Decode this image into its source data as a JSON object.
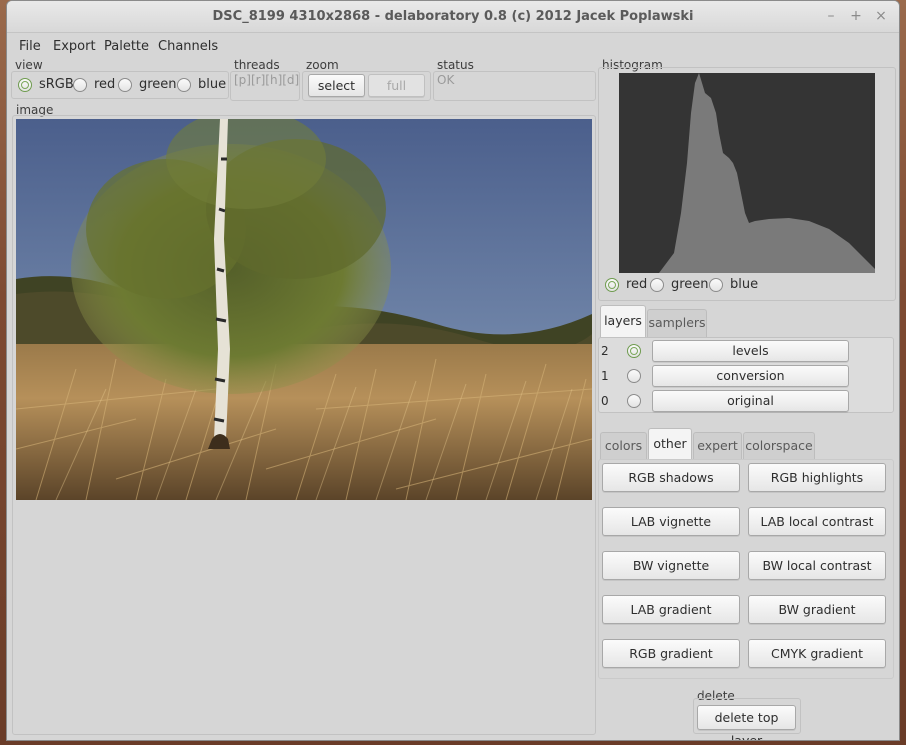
{
  "window": {
    "title": "DSC_8199 4310x2868 - delaboratory 0.8 (c) 2012 Jacek Poplawski"
  },
  "menu": [
    "File",
    "Export",
    "Palette",
    "Channels"
  ],
  "view": {
    "label": "view",
    "options": [
      "sRGB",
      "red",
      "green",
      "blue"
    ],
    "selected": "sRGB"
  },
  "threads": {
    "label": "threads",
    "value": "[p][r][h][d]"
  },
  "zoom": {
    "label": "zoom",
    "select_label": "select",
    "full_label": "full"
  },
  "status": {
    "label": "status",
    "value": "OK"
  },
  "image": {
    "label": "image"
  },
  "histogram": {
    "label": "histogram",
    "channels": [
      "red",
      "green",
      "blue"
    ],
    "selected": "red"
  },
  "layer_tabs": [
    "layers",
    "samplers"
  ],
  "layers": [
    {
      "index": "2",
      "name": "levels",
      "active": true
    },
    {
      "index": "1",
      "name": "conversion",
      "active": false
    },
    {
      "index": "0",
      "name": "original",
      "active": false
    }
  ],
  "action_tabs": [
    "colors",
    "other",
    "expert",
    "colorspace"
  ],
  "actions": [
    [
      "RGB shadows",
      "RGB highlights"
    ],
    [
      "LAB vignette",
      "LAB local contrast"
    ],
    [
      "BW vignette",
      "BW local contrast"
    ],
    [
      "LAB gradient",
      "BW gradient"
    ],
    [
      "RGB gradient",
      "CMYK gradient"
    ]
  ],
  "delete": {
    "label": "delete",
    "button": "delete top layer"
  },
  "icons": {
    "minimize": "minimize-icon",
    "maximize": "maximize-icon",
    "close": "close-icon"
  }
}
